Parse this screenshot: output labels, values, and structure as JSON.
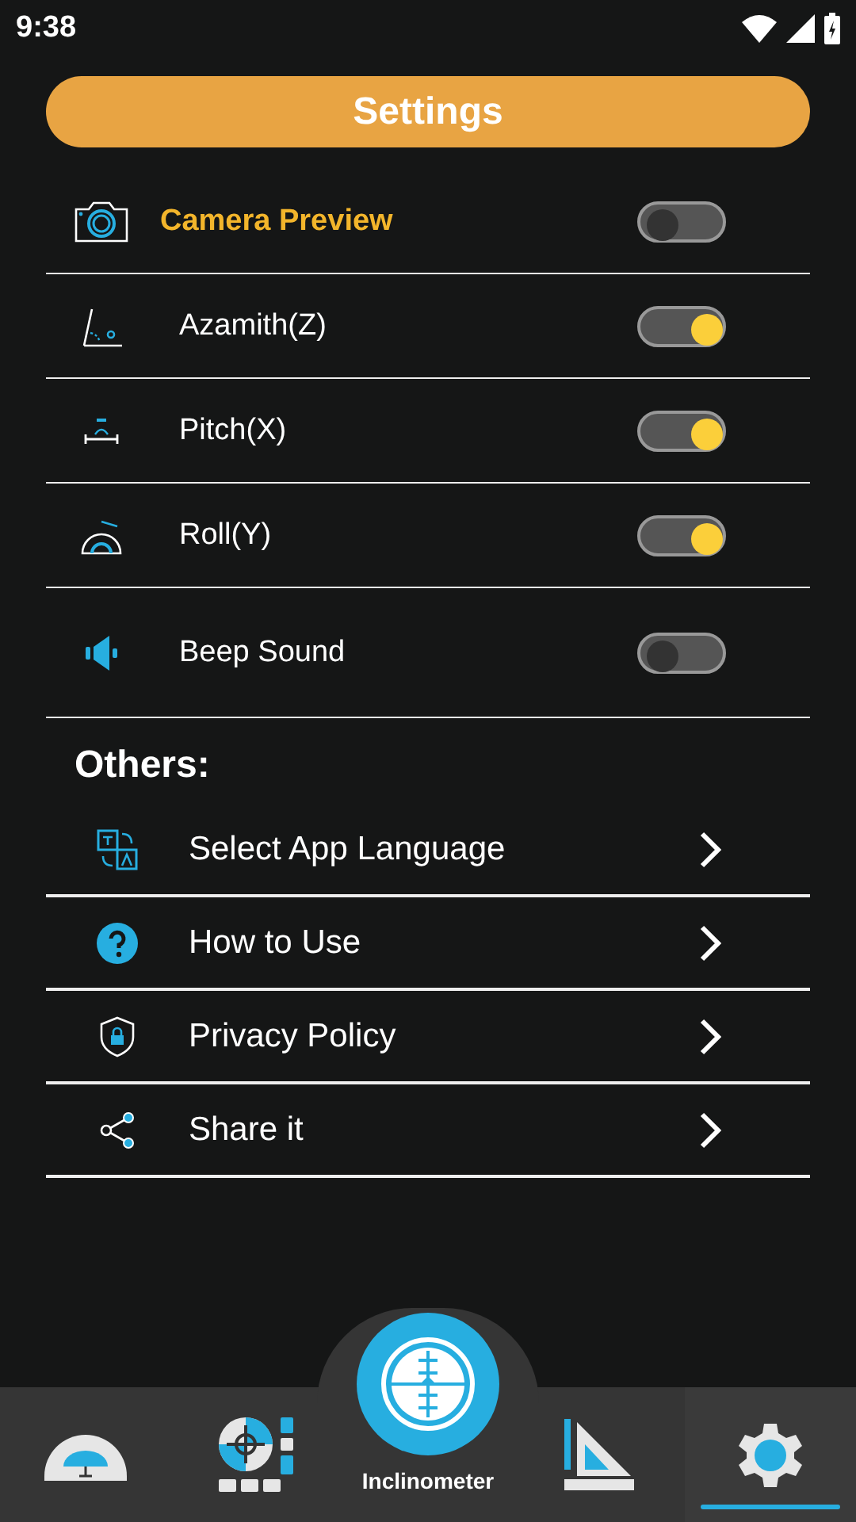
{
  "status_bar": {
    "time": "9:38"
  },
  "title": "Settings",
  "toggles": [
    {
      "kind": "feature",
      "label": "Camera Preview",
      "on": false
    },
    {
      "kind": "axis",
      "label": "Azamith(Z)",
      "on": true
    },
    {
      "kind": "axis",
      "label": "Pitch(X)",
      "on": true
    },
    {
      "kind": "axis",
      "label": "Roll(Y)",
      "on": true
    },
    {
      "kind": "axis",
      "label": "Beep Sound",
      "on": false
    }
  ],
  "others": {
    "heading": "Others:",
    "items": [
      {
        "label": "Select App Language"
      },
      {
        "label": "How to Use"
      },
      {
        "label": "Privacy Policy"
      },
      {
        "label": "Share it"
      }
    ]
  },
  "bottom_nav": [
    {
      "kind": "tab",
      "selected": false
    },
    {
      "kind": "tab",
      "selected": false
    },
    {
      "kind": "center",
      "label": "Inclinometer",
      "selected": false
    },
    {
      "kind": "tab",
      "selected": false
    },
    {
      "kind": "tab",
      "selected": true
    }
  ]
}
